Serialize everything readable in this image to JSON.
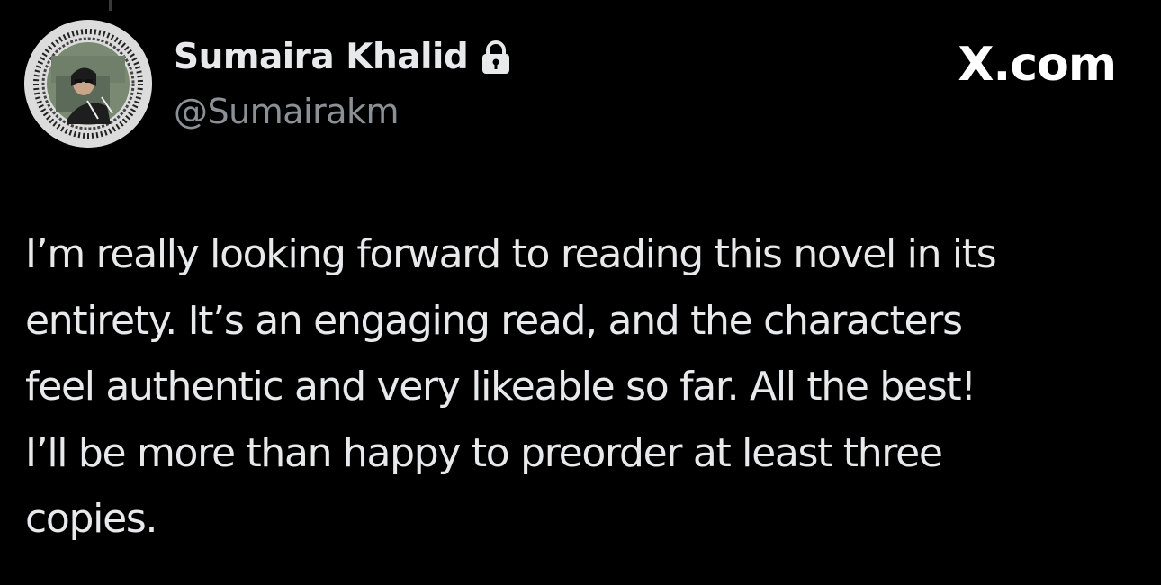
{
  "author": {
    "display_name": "Sumaira Khalid",
    "handle": "@Sumairakm",
    "protected_icon": "lock-icon",
    "avatar": "profile-photo"
  },
  "brand": {
    "label": "X.com"
  },
  "tweet": {
    "lines": [
      "I’m really looking forward to reading this novel in its",
      "entirety. It’s an engaging read, and the characters",
      "feel authentic and very likeable so far. All the best!",
      "I’ll be more than happy to preorder at least three",
      "copies."
    ]
  },
  "colors": {
    "background": "#000000",
    "primary_text": "#e7e9ea",
    "secondary_text": "#8b9096",
    "brand_text": "#ffffff"
  }
}
